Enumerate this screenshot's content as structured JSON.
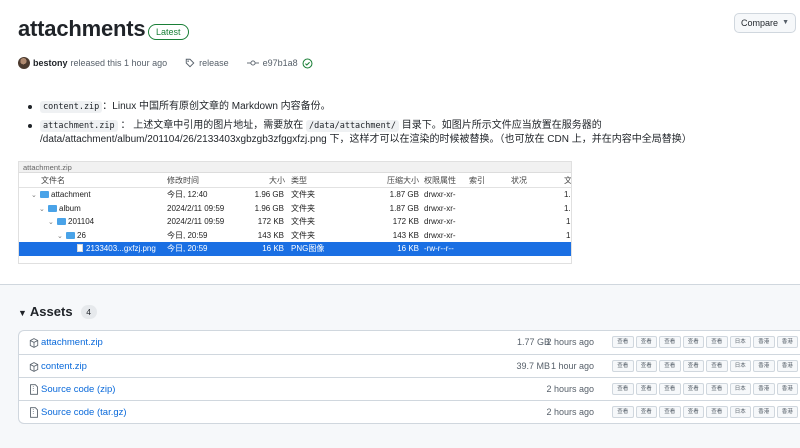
{
  "release": {
    "title": "attachments",
    "badge": "Latest",
    "compare_label": "Compare",
    "author": "bestony",
    "released_text": "released this 1 hour ago",
    "tag": "release",
    "commit": "e97b1a8"
  },
  "notes": {
    "item1": {
      "code": "content.zip",
      "text": "：Linux 中国所有原创文章的 Markdown 内容备份。"
    },
    "item2": {
      "code": "attachment.zip",
      "text_a": "： 上述文章中引用的图片地址，需要放在",
      "code2": "/data/attachment/",
      "text_b": "目录下。如图片所示文件应当放置在服务器的",
      "text_c": "/data/attachment/album/201104/26/2133403xgbzgb3zfggxfzj.png 下，这样才可以在渲染的时候被替换。（也可放在 CDN 上，并在内容中全局替换）"
    }
  },
  "finder": {
    "window_title": "attachment.zip",
    "headers": {
      "name": "文件名",
      "modified": "修改时间",
      "size": "大小",
      "kind": "类型",
      "packed": "压缩大小",
      "perm": "权限属性",
      "index": "索引",
      "status": "状况",
      "extra": "文"
    },
    "rows": [
      {
        "name": "attachment",
        "modified": "今日, 12:40",
        "size": "1.96 GB",
        "kind": "文件夹",
        "packed": "1.87 GB",
        "perm": "drwxr-xr-",
        "extra": "1."
      },
      {
        "name": "album",
        "modified": "2024/2/11 09:59",
        "size": "1.96 GB",
        "kind": "文件夹",
        "packed": "1.87 GB",
        "perm": "drwxr-xr-",
        "extra": "1."
      },
      {
        "name": "201104",
        "modified": "2024/2/11 09:59",
        "size": "172 KB",
        "kind": "文件夹",
        "packed": "172 KB",
        "perm": "drwxr-xr-",
        "extra": "1"
      },
      {
        "name": "26",
        "modified": "今日, 20:59",
        "size": "143 KB",
        "kind": "文件夹",
        "packed": "143 KB",
        "perm": "drwxr-xr-",
        "extra": "1"
      },
      {
        "name": "2133403...gxfzj.png",
        "modified": "今日, 20:59",
        "size": "16 KB",
        "kind": "PNG图像",
        "packed": "16 KB",
        "perm": "-rw-r--r--",
        "extra": ""
      }
    ]
  },
  "assets": {
    "title": "Assets",
    "count": "4",
    "items": [
      {
        "name": "attachment.zip",
        "size": "1.77 GB",
        "time": "2 hours ago"
      },
      {
        "name": "content.zip",
        "size": "39.7 MB",
        "time": "1 hour ago"
      },
      {
        "name": "Source code (zip)",
        "size": "",
        "time": "2 hours ago"
      },
      {
        "name": "Source code (tar.gz)",
        "size": "",
        "time": "2 hours ago"
      }
    ],
    "tags": [
      "查看",
      "查看",
      "查看",
      "查看",
      "查看",
      "日本",
      "香港",
      "香港"
    ]
  }
}
